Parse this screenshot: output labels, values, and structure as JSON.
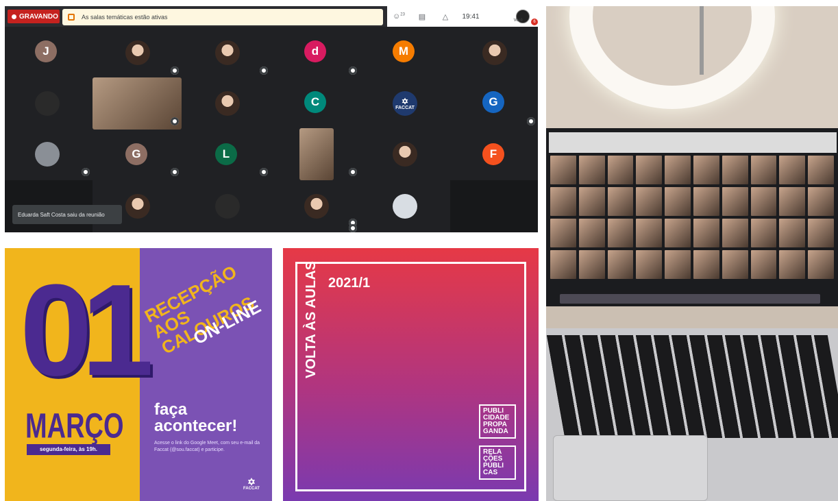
{
  "meet": {
    "recording_label": "GRAVANDO",
    "banner_text": "As salas temáticas estão ativas",
    "participants_count": "23",
    "time": "19:41",
    "you_label": "Você",
    "notification_count": "6",
    "toast_text": "Eduarda Saft Costa saiu da reunião",
    "letters": [
      {
        "letter": "J",
        "color": "#8d6e63"
      },
      {
        "letter": "d",
        "color": "#d81b60"
      },
      {
        "letter": "M",
        "color": "#f57c00"
      },
      {
        "letter": "C",
        "color": "#00897b"
      },
      {
        "letter": "G",
        "color": "#1565c0"
      },
      {
        "letter": "G",
        "color": "#8d6e63"
      },
      {
        "letter": "L",
        "color": "#0b6b47"
      },
      {
        "letter": "F",
        "color": "#f4511e"
      }
    ],
    "faccat_tile_label": "FACCAT"
  },
  "poster1": {
    "day": "01",
    "month": "MARÇO",
    "weekday": "segunda-feira, às 19h.",
    "headline_1": "RECEPÇÃO",
    "headline_2": "AOS CALOUROS",
    "headline_3": "ON-LINE",
    "call": "faça acontecer!",
    "body": "Acesse o link do Google Meet, com seu e-mail da Faccat (@sou.faccat) e participe.",
    "logo": "FACCAT"
  },
  "poster2": {
    "vertical_title": "VOLTA ÀS AULAS",
    "year": "2021/1",
    "box1": "PUBLI CIDADE PROPA GANDA",
    "box2": "RELA ÇÕES PÚBLI CAS"
  }
}
